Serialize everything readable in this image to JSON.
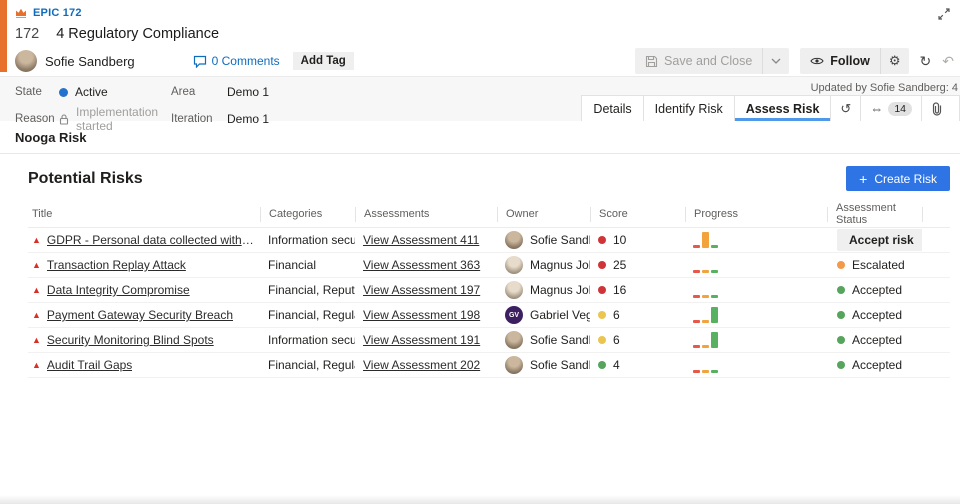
{
  "colors": {
    "epic_orange": "#e8702d",
    "link_blue": "#0f6cbd",
    "primary_button_blue": "#2e74e5",
    "tab_underline_blue": "#4f9ae8",
    "state_dot_blue": "#2472cc",
    "warning_red": "#d93025",
    "progress": {
      "red": "#e8584a",
      "orange": "#f2a33c",
      "green": "#57b161"
    }
  },
  "header": {
    "type_label": "EPIC 172",
    "id": "172",
    "title": "4 Regulatory Compliance",
    "assigned_to": "Sofie Sandberg",
    "comments_label": "0 Comments",
    "add_tag_label": "Add Tag",
    "save_and_close_label": "Save and Close",
    "follow_label": "Follow",
    "updated_text": "Updated by Sofie Sandberg: 4"
  },
  "fields": {
    "state_label": "State",
    "state_value": "Active",
    "reason_label": "Reason",
    "reason_value": "Implementation started",
    "area_label": "Area",
    "area_value": "Demo 1",
    "iteration_label": "Iteration",
    "iteration_value": "Demo 1"
  },
  "tabs": [
    {
      "label": "Details",
      "active": false
    },
    {
      "label": "Identify Risk",
      "active": false
    },
    {
      "label": "Assess Risk",
      "active": true
    }
  ],
  "links_badge": "14",
  "section": {
    "extension_title": "Nooga Risk",
    "heading": "Potential Risks",
    "create_button_label": "Create Risk"
  },
  "table": {
    "columns": [
      "Title",
      "Categories",
      "Assessments",
      "Owner",
      "Score",
      "Progress",
      "Assessment Status"
    ],
    "rows": [
      {
        "title": "GDPR - Personal data collected without consent",
        "categories": "Information security...",
        "assessment": "View Assessment 411",
        "owner": "Sofie Sandberg",
        "avatar": "sofie",
        "initials": "SS",
        "score": "10",
        "score_color": "#d13438",
        "progress": [
          3,
          16,
          3
        ],
        "status": "Accept risk",
        "status_style": "button",
        "status_color": ""
      },
      {
        "title": "Transaction Replay Attack",
        "categories": "Financial",
        "assessment": "View Assessment 363",
        "owner": "Magnus Johansson",
        "avatar": "magnus",
        "initials": "MJ",
        "score": "25",
        "score_color": "#d13438",
        "progress": [
          3,
          3,
          3
        ],
        "status": "Escalated",
        "status_style": "dot",
        "status_color": "#f2994a"
      },
      {
        "title": "Data Integrity Compromise",
        "categories": "Financial, Reputatio...",
        "assessment": "View Assessment 197",
        "owner": "Magnus Johansson",
        "avatar": "magnus",
        "initials": "MJ",
        "score": "16",
        "score_color": "#d13438",
        "progress": [
          3,
          3,
          3
        ],
        "status": "Accepted",
        "status_style": "dot",
        "status_color": "#57a45c"
      },
      {
        "title": "Payment Gateway Security Breach",
        "categories": "Financial, Regulatory",
        "assessment": "View Assessment 198",
        "owner": "Gabriel Vega",
        "avatar": "gabriel",
        "initials": "GV",
        "score": "6",
        "score_color": "#eac54f",
        "progress": [
          3,
          3,
          16
        ],
        "status": "Accepted",
        "status_style": "dot",
        "status_color": "#57a45c"
      },
      {
        "title": "Security Monitoring Blind Spots",
        "categories": "Information security",
        "assessment": "View Assessment 191",
        "owner": "Sofie Sandberg",
        "avatar": "sofie",
        "initials": "SS",
        "score": "6",
        "score_color": "#eac54f",
        "progress": [
          3,
          3,
          16
        ],
        "status": "Accepted",
        "status_style": "dot",
        "status_color": "#57a45c"
      },
      {
        "title": "Audit Trail Gaps",
        "categories": "Financial, Regulatory",
        "assessment": "View Assessment 202",
        "owner": "Sofie Sandberg",
        "avatar": "sofie",
        "initials": "SS",
        "score": "4",
        "score_color": "#57a45c",
        "progress": [
          3,
          3,
          3
        ],
        "status": "Accepted",
        "status_style": "dot",
        "status_color": "#57a45c"
      }
    ]
  }
}
